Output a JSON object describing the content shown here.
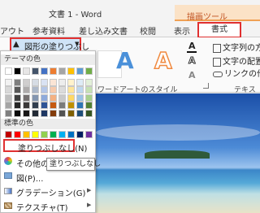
{
  "window": {
    "title": "文書 1 - Word",
    "context_tool": "描画ツール"
  },
  "tabs": [
    {
      "label": "アウト"
    },
    {
      "label": "参考資料"
    },
    {
      "label": "差し込み文書"
    },
    {
      "label": "校閲"
    },
    {
      "label": "表示"
    },
    {
      "label": "書式"
    }
  ],
  "ribbon": {
    "fill_dropdown_label": "図形の塗りつぶし",
    "wordart_group_label": "ワードアートのスタイル",
    "text_group_label": "テキスト",
    "text_direction": "文字列の方",
    "text_align": "文字の配置",
    "create_link": "リンクの作成",
    "wordart_letter": "A"
  },
  "panel": {
    "theme_colors_label": "テーマの色",
    "standard_colors_label": "標準の色",
    "no_fill": "塗りつぶしなし(N)",
    "more_colors": "その他の色",
    "picture": "図(P)...",
    "gradient": "グラデーション(G)",
    "texture": "テクスチャ(T)",
    "tooltip": "塗りつぶしなし",
    "theme_colors": [
      [
        "#ffffff",
        "#000000",
        "#e7e6e6",
        "#44546a",
        "#4472c4",
        "#ed7d31",
        "#a5a5a5",
        "#ffc000",
        "#5b9bd5",
        "#70ad47"
      ],
      [
        "#f2f2f2",
        "#7f7f7f",
        "#d0cece",
        "#d6dce4",
        "#d9e2f3",
        "#fbe5d5",
        "#ededed",
        "#fff2cc",
        "#deebf6",
        "#e2efd9"
      ],
      [
        "#d8d8d8",
        "#595959",
        "#aeabab",
        "#adb9ca",
        "#b4c6e7",
        "#f7caac",
        "#dbdbdb",
        "#fee599",
        "#bdd7ee",
        "#c5e0b3"
      ],
      [
        "#bfbfbf",
        "#3f3f3f",
        "#757070",
        "#8496b0",
        "#8eaadb",
        "#f4b183",
        "#c9c9c9",
        "#ffd965",
        "#9cc3e5",
        "#a8d08d"
      ],
      [
        "#a5a5a5",
        "#262626",
        "#3a3838",
        "#323f4f",
        "#2f5496",
        "#c55a11",
        "#7b7b7b",
        "#bf9000",
        "#2e75b5",
        "#538135"
      ],
      [
        "#7f7f7f",
        "#0c0c0c",
        "#171616",
        "#222a35",
        "#1f3864",
        "#833c0b",
        "#525252",
        "#7f6000",
        "#1e4e79",
        "#375623"
      ]
    ],
    "standard_colors": [
      "#c00000",
      "#ff0000",
      "#ffc000",
      "#ffff00",
      "#92d050",
      "#00b050",
      "#00b0f0",
      "#0070c0",
      "#002060",
      "#7030a0"
    ]
  }
}
